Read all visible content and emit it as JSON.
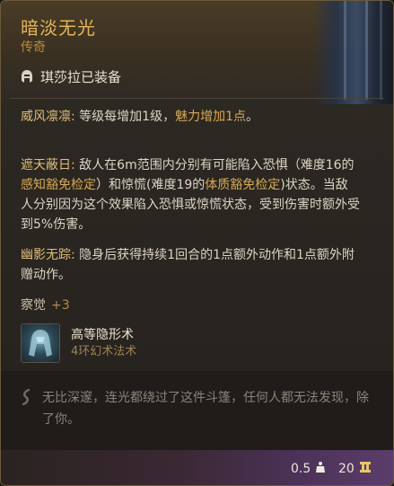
{
  "item": {
    "name": "暗淡无光",
    "rarity": "传奇",
    "equipped_by": "琪莎拉已装备"
  },
  "properties": [
    {
      "label": "威风凛凛:",
      "text_a": " 等级每增加1级，",
      "highlight": "魅力增加1点",
      "text_b": "。"
    },
    {
      "label": "遮天蔽日:",
      "text_a": " 敌人在6m范围内分别有可能陷入恐惧（难度16的",
      "highlight": "感知豁免检定",
      "text_b": "）和惊慌(难度19的",
      "highlight2": "体质豁免检定",
      "text_c": ")状态。当敌人分别因为这个效果陷入恐惧或惊慌状态，受到伤害时额外受到5%伤害。"
    },
    {
      "label": "幽影无踪:",
      "text_a": " 隐身后获得持续1回合的1点额外动作和1点额外附赠动作。"
    }
  ],
  "bonus": {
    "label": "察觉",
    "value": "+3"
  },
  "spell": {
    "name": "高等隐形术",
    "school": "4环幻术法术"
  },
  "flavor": "无比深邃，连光都绕过了这件斗篷，任何人都无法发现，除了你。",
  "footer": {
    "weight": "0.5",
    "price": "20"
  },
  "icons": {
    "equipped": "helmet-icon",
    "spell": "cloak-spell-icon",
    "flavor": "quote-icon",
    "weight": "weight-icon",
    "price": "coin-icon"
  },
  "colors": {
    "title": "#e3b45a",
    "rarity": "#b98b3f",
    "keyword": "#e0bf7a",
    "footer_accent": "#5b3d6b"
  }
}
